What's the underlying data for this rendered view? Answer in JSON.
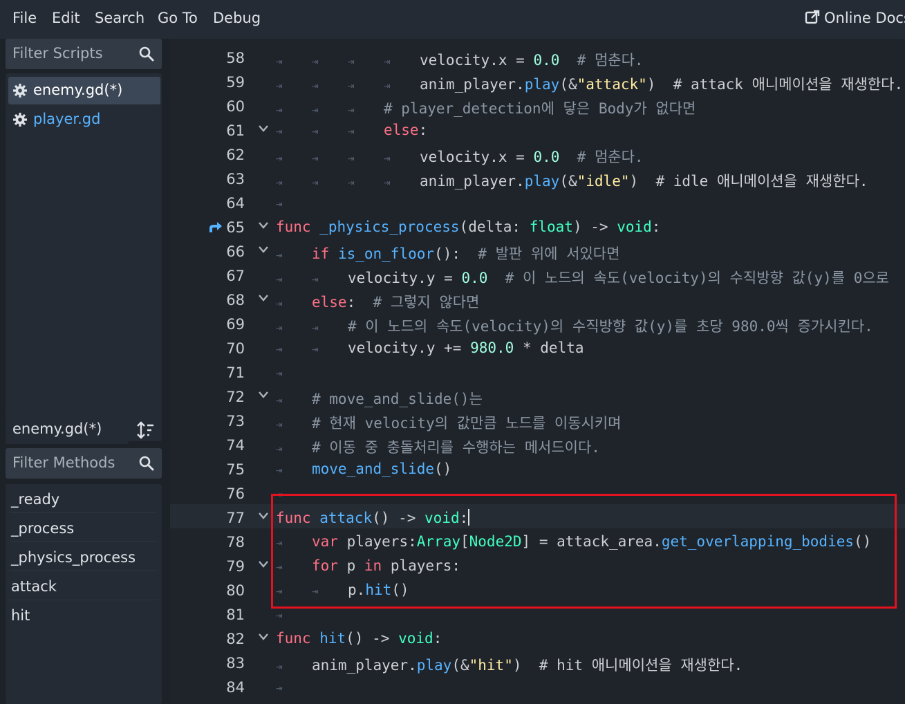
{
  "menubar": {
    "items": [
      "File",
      "Edit",
      "Search",
      "Go To",
      "Debug"
    ],
    "online_docs": "Online Docs"
  },
  "scripts_panel": {
    "filter_placeholder": "Filter Scripts",
    "items": [
      {
        "label": "enemy.gd(*)",
        "selected": true
      },
      {
        "label": "player.gd",
        "selected": false
      }
    ]
  },
  "methods_panel": {
    "current_script": "enemy.gd(*)",
    "filter_placeholder": "Filter Methods",
    "items": [
      "_ready",
      "_process",
      "_physics_process",
      "attack",
      "hit"
    ]
  },
  "editor": {
    "current_line": 77,
    "lines": [
      {
        "n": "58",
        "t": "velocity.x = 0.0  # 멈춘다."
      },
      {
        "n": "59",
        "t": "anim_player.play(&\"attack\")  # attack 애니메이션을 재생한다."
      },
      {
        "n": "60",
        "t": "# player_detection에 닿은 Body가 없다면"
      },
      {
        "n": "61",
        "t": "else:"
      },
      {
        "n": "62",
        "t": "velocity.x = 0.0  # 멈춘다."
      },
      {
        "n": "63",
        "t": "anim_player.play(&\"idle\")  # idle 애니메이션을 재생한다."
      },
      {
        "n": "64",
        "t": ""
      },
      {
        "n": "65",
        "t": "func _physics_process(delta: float) -> void:"
      },
      {
        "n": "66",
        "t": "if is_on_floor():  # 발판 위에 서있다면"
      },
      {
        "n": "67",
        "t": "velocity.y = 0.0  # 이 노드의 속도(velocity)의 수직방향 값(y)를 0으로"
      },
      {
        "n": "68",
        "t": "else:  # 그렇지 않다면"
      },
      {
        "n": "69",
        "t": "# 이 노드의 속도(velocity)의 수직방향 값(y)를 초당 980.0씩 증가시킨다."
      },
      {
        "n": "70",
        "t": "velocity.y += 980.0 * delta"
      },
      {
        "n": "71",
        "t": ""
      },
      {
        "n": "72",
        "t": "# move_and_slide()는"
      },
      {
        "n": "73",
        "t": "# 현재 velocity의 값만큼 노드를 이동시키며"
      },
      {
        "n": "74",
        "t": "# 이동 중 충돌처리를 수행하는 메서드이다."
      },
      {
        "n": "75",
        "t": "move_and_slide()"
      },
      {
        "n": "76",
        "t": ""
      },
      {
        "n": "77",
        "t": "func attack() -> void:"
      },
      {
        "n": "78",
        "t": "var players:Array[Node2D] = attack_area.get_overlapping_bodies()"
      },
      {
        "n": "79",
        "t": "for p in players:"
      },
      {
        "n": "80",
        "t": "p.hit()"
      },
      {
        "n": "81",
        "t": ""
      },
      {
        "n": "82",
        "t": "func hit() -> void:"
      },
      {
        "n": "83",
        "t": "anim_player.play(&\"hit\")  # hit 애니메이션을 재생한다."
      },
      {
        "n": "84",
        "t": ""
      }
    ]
  },
  "colors": {
    "keyword": "#ff7085",
    "function": "#57b3ff",
    "type": "#42ffc2",
    "number": "#a1ffe0",
    "string": "#ffeda1",
    "comment": "#8c97a3",
    "highlight_box": "#e3121e",
    "selected_item": "#3b4756",
    "link_text": "#57b3ff"
  },
  "icons": {
    "online_docs": "external-link-icon",
    "filter": "search-icon",
    "script": "gear-icon",
    "sort": "sort-icon",
    "fold": "chevron-down-icon",
    "indent": "tab-arrow-icon",
    "breakpoint_arrow": "jump-arrow-icon"
  }
}
